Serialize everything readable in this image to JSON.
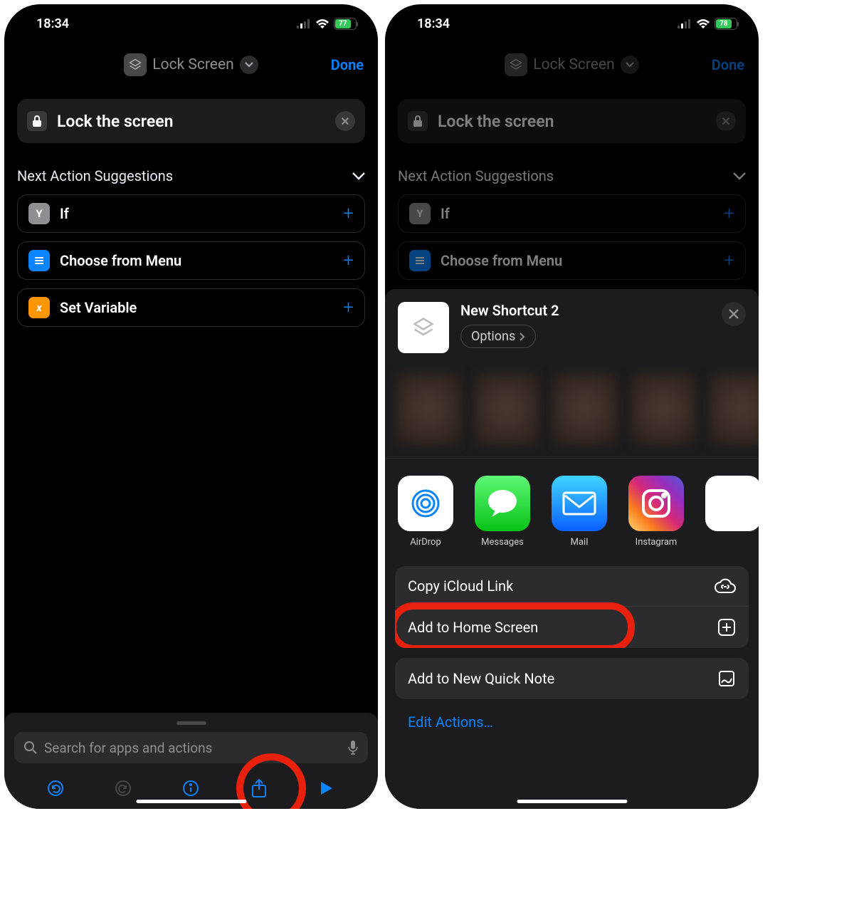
{
  "left": {
    "status": {
      "time": "18:34",
      "battery_pct": "77",
      "battery_width": "77%"
    },
    "header": {
      "title": "Lock Screen",
      "done": "Done"
    },
    "action_card": {
      "label": "Lock the screen"
    },
    "section_title": "Next Action Suggestions",
    "suggestions": [
      {
        "label": "If",
        "color": "#8e8e93",
        "glyph": "Y"
      },
      {
        "label": "Choose from Menu",
        "color": "#0a84ff",
        "glyph": "≡"
      },
      {
        "label": "Set Variable",
        "color": "#ff9500",
        "glyph": "x"
      }
    ],
    "search_placeholder": "Search for apps and actions"
  },
  "right": {
    "status": {
      "time": "18:34",
      "battery_pct": "78",
      "battery_width": "78%"
    },
    "header": {
      "title": "Lock Screen",
      "done": "Done"
    },
    "action_card": {
      "label": "Lock the screen"
    },
    "section_title": "Next Action Suggestions",
    "suggestions": [
      {
        "label": "If",
        "color": "#8e8e93",
        "glyph": "Y"
      },
      {
        "label": "Choose from Menu",
        "color": "#0a84ff",
        "glyph": "≡"
      }
    ],
    "share": {
      "title": "New Shortcut 2",
      "options": "Options",
      "apps": [
        {
          "label": "AirDrop",
          "bg": "#ffffff",
          "svg": "airdrop"
        },
        {
          "label": "Messages",
          "bg": "linear-gradient(#5ff777,#07c316)",
          "svg": "messages"
        },
        {
          "label": "Mail",
          "bg": "linear-gradient(#3ed4ff,#0a60ff)",
          "svg": "mail"
        },
        {
          "label": "Instagram",
          "bg": "linear-gradient(45deg,#feda75,#fa7e1e,#d62976,#962fbf,#4f5bd5)",
          "svg": "instagram"
        }
      ],
      "actions": {
        "group1": [
          {
            "label": "Copy iCloud Link",
            "icon": "cloud"
          },
          {
            "label": "Add to Home Screen",
            "icon": "plusbox",
            "highlight": true
          }
        ],
        "group2": [
          {
            "label": "Add to New Quick Note",
            "icon": "note"
          }
        ]
      },
      "edit": "Edit Actions…"
    }
  }
}
